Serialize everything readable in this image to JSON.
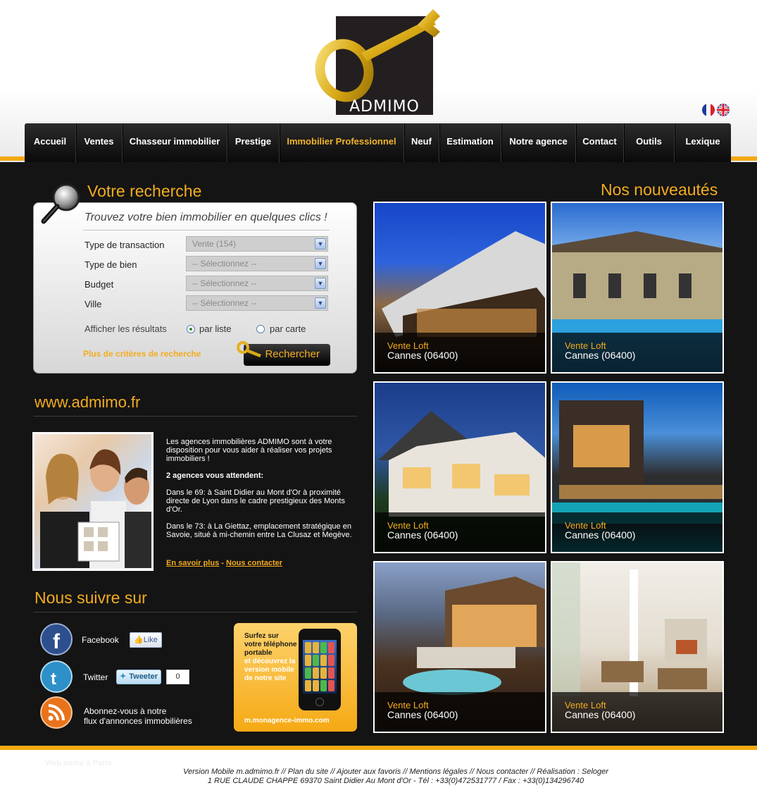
{
  "logo": {
    "brand": "ADMIMO"
  },
  "nav": {
    "items": [
      {
        "label": "Accueil"
      },
      {
        "label": "Ventes"
      },
      {
        "label": "Chasseur immobilier"
      },
      {
        "label": "Prestige"
      },
      {
        "label": "Immobilier Professionnel",
        "active": true
      },
      {
        "label": "Neuf"
      },
      {
        "label": "Estimation"
      },
      {
        "label": "Notre agence"
      },
      {
        "label": "Contact"
      },
      {
        "label": "Outils"
      },
      {
        "label": "Lexique"
      }
    ]
  },
  "search": {
    "title": "Votre recherche",
    "tagline": "Trouvez votre bien immobilier en quelques clics !",
    "fields": [
      {
        "label": "Type de transaction",
        "value": "Vente (154)"
      },
      {
        "label": "Type de bien",
        "value": "-- Sélectionnez --"
      },
      {
        "label": "Budget",
        "value": "-- Sélectionnez --"
      },
      {
        "label": "Ville",
        "value": "-- Sélectionnez --"
      }
    ],
    "display_label": "Afficher les résultats",
    "option_list": "par liste",
    "option_map": "par carte",
    "more_criteria": "Plus de critères de recherche",
    "button": "Rechercher"
  },
  "site": {
    "title": "www.admimo.fr",
    "intro": "Les agences immobilières ADMIMO sont à votre disposition pour vous aider à réaliser vos projets immobiliers !",
    "agencies": "2 agences vous attendent:",
    "agency1": "Dans le 69: à Saint Didier au Mont d'Or à proximité directe de Lyon dans le cadre prestigieux des Monts d'Or.",
    "agency2": "Dans le 73: à La Giettaz, emplacement stratégique en Savoie, situé à mi-chemin entre La Clusaz et Megève.",
    "link_more": "En savoir plus",
    "link_sep": "-",
    "link_contact": "Nous contacter"
  },
  "social": {
    "title": "Nous suivre sur",
    "facebook": "Facebook",
    "like": "Like",
    "twitter": "Twitter",
    "tweet": "Tweeter",
    "tweet_count": "0",
    "rss_line1": "Abonnez-vous à notre",
    "rss_line2": "flux d'annonces immobilières"
  },
  "mobile": {
    "line1": "Surfez sur votre téléphone portable",
    "line2": "et découvrez la version mobile de notre site",
    "url": "m.monagence-immo.com"
  },
  "listings": {
    "title": "Nos nouveautés",
    "items": [
      {
        "type": "Vente Loft",
        "city": "Cannes (06400)"
      },
      {
        "type": "Vente Loft",
        "city": "Cannes (06400)"
      },
      {
        "type": "Vente Loft",
        "city": "Cannes (06400)"
      },
      {
        "type": "Vente Loft",
        "city": "Cannes (06400)"
      },
      {
        "type": "Vente Loft",
        "city": "Cannes (06400)"
      },
      {
        "type": "Vente Loft",
        "city": "Cannes (06400)"
      }
    ]
  },
  "footer": {
    "ghost": "Web Immo à Paris",
    "links_line": "Version Mobile m.admimo.fr //  Plan du site  //  Ajouter aux favoris  //  Mentions légales  //  Nous contacter  //  Réalisation : Seloger",
    "address": "1 RUE CLAUDE CHAPPE 69370 Saint Didier Au Mont d'Or - Tél : +33(0)472531777 / Fax : +33(0)134296740"
  },
  "colors": {
    "accent": "#f3ac1f",
    "background_dark": "#141414"
  }
}
